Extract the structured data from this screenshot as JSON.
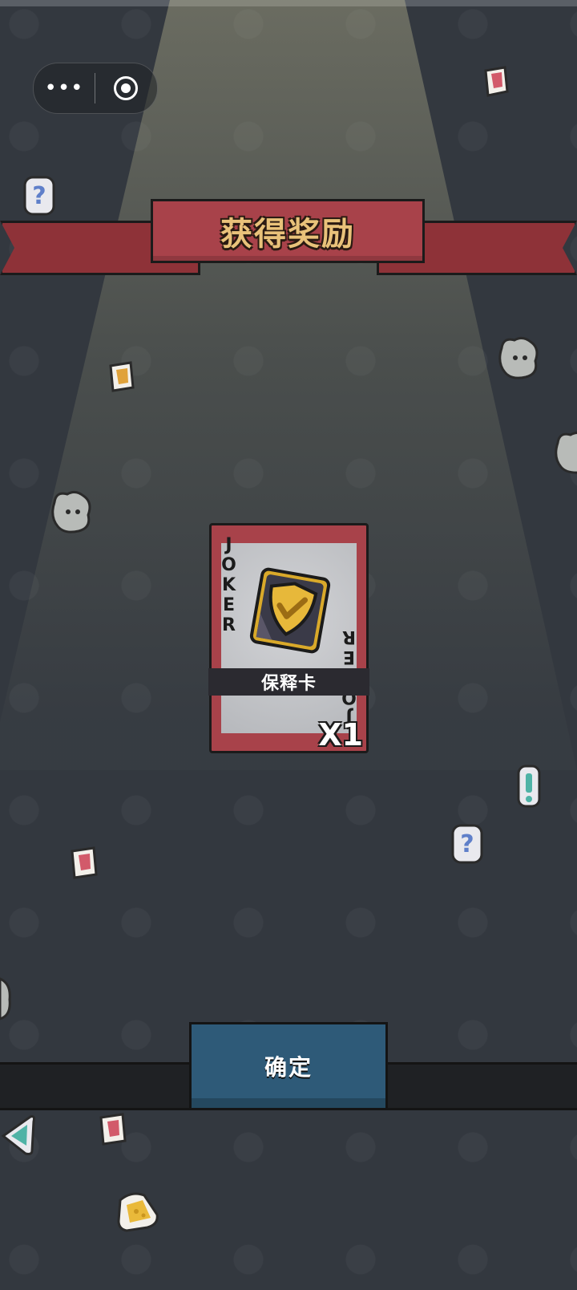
{
  "app": {
    "title_banner": "获得奖励",
    "capsule": {
      "more_glyph": "•••",
      "close_icon": "target-close"
    }
  },
  "reward_card": {
    "side_text": "JOKER",
    "name": "保释卡",
    "count": "X1",
    "icon": "shield-check-card"
  },
  "actions": {
    "confirm_label": "确定"
  },
  "colors": {
    "background": "#33383f",
    "banner_red": "#a8424a",
    "banner_text": "#e9c27a",
    "card_red": "#a8424a",
    "button_blue": "#2e5a78",
    "gold": "#d9a92a"
  },
  "decor_stickers": [
    "question-sticker",
    "exclamation-sticker",
    "card-sticker",
    "mouse-sticker",
    "cheese-sticker",
    "triangle-sticker"
  ]
}
